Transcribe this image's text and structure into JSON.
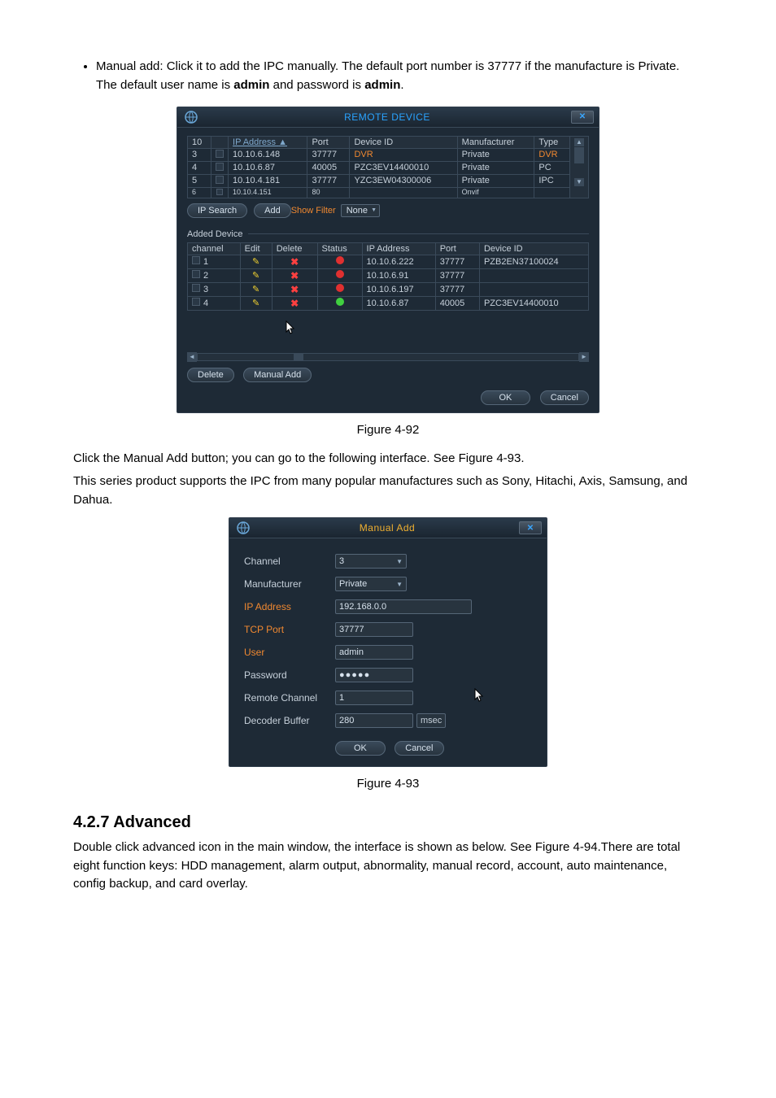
{
  "doc": {
    "bullet_label": "Manual add: Click it to add the IPC manually. The default port number is 37777 if the manufacture is Private. The default user name is ",
    "bullet_bold1": "admin",
    "bullet_mid": " and password is ",
    "bullet_bold2": "admin",
    "bullet_end": ".",
    "para1": "Click the Manual Add button; you can go to the following interface. See Figure 4-93.",
    "para2": "This series product supports the IPC from many popular manufactures such as Sony, Hitachi, Axis, Samsung, and Dahua.",
    "section_heading": "4.2.7 Advanced",
    "para3": "Double click advanced icon in the main window, the interface is shown as below. See Figure 4-94.There are total eight function keys: HDD management, alarm output, abnormality, manual record, account, auto maintenance, config backup, and card overlay.",
    "fig1": "Figure 4-92",
    "fig2": "Figure 4-93"
  },
  "remote": {
    "title": "REMOTE DEVICE",
    "headers": {
      "count": "10",
      "ip_address": "IP Address",
      "port": "Port",
      "device_id": "Device ID",
      "manufacturer": "Manufacturer",
      "type": "Type"
    },
    "rows": [
      {
        "n": "3",
        "ip": "10.10.6.148",
        "port": "37777",
        "dev": "DVR",
        "mfr": "Private",
        "type": "DVR"
      },
      {
        "n": "4",
        "ip": "10.10.6.87",
        "port": "40005",
        "dev": "PZC3EV14400010",
        "mfr": "Private",
        "type": "PC"
      },
      {
        "n": "5",
        "ip": "10.10.4.181",
        "port": "37777",
        "dev": "YZC3EW04300006",
        "mfr": "Private",
        "type": "IPC"
      },
      {
        "n": "6",
        "ip": "10.10.4.151",
        "port": "80",
        "dev": "",
        "mfr": "Onvif",
        "type": ""
      }
    ],
    "buttons": {
      "ip_search": "IP Search",
      "add": "Add",
      "delete": "Delete",
      "manual_add": "Manual Add",
      "ok": "OK",
      "cancel": "Cancel"
    },
    "show_filter_label": "Show Filter",
    "show_filter_value": "None",
    "added_device_label": "Added Device",
    "added_headers": {
      "channel": "channel",
      "edit": "Edit",
      "delete": "Delete",
      "status": "Status",
      "ip": "IP Address",
      "port": "Port",
      "device_id": "Device ID"
    },
    "added_rows": [
      {
        "ch": "1",
        "status": "red",
        "ip": "10.10.6.222",
        "port": "37777",
        "dev": "PZB2EN37100024"
      },
      {
        "ch": "2",
        "status": "red",
        "ip": "10.10.6.91",
        "port": "37777",
        "dev": ""
      },
      {
        "ch": "3",
        "status": "red",
        "ip": "10.10.6.197",
        "port": "37777",
        "dev": ""
      },
      {
        "ch": "4",
        "status": "green",
        "ip": "10.10.6.87",
        "port": "40005",
        "dev": "PZC3EV14400010"
      }
    ]
  },
  "manual": {
    "title": "Manual Add",
    "labels": {
      "channel": "Channel",
      "manufacturer": "Manufacturer",
      "ip": "IP Address",
      "tcp": "TCP Port",
      "user": "User",
      "password": "Password",
      "remote_channel": "Remote Channel",
      "decoder_buffer": "Decoder Buffer"
    },
    "values": {
      "channel": "3",
      "manufacturer": "Private",
      "ip": "192.168.0.0",
      "tcp": "37777",
      "user": "admin",
      "password_display": "●●●●●",
      "remote_channel": "1",
      "decoder_buffer": "280",
      "decoder_unit": "msec"
    },
    "buttons": {
      "ok": "OK",
      "cancel": "Cancel"
    }
  }
}
